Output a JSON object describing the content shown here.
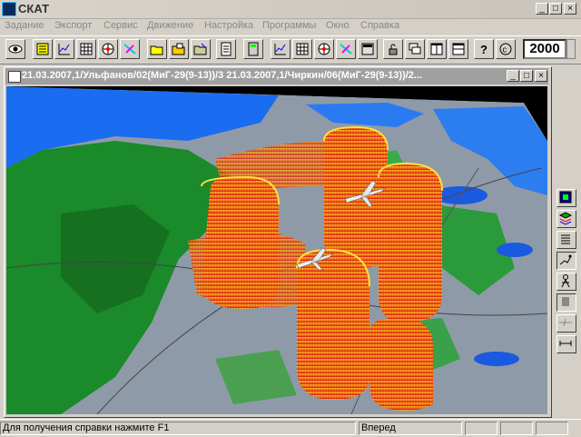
{
  "app": {
    "title": "СКАТ"
  },
  "menu": [
    "Задание",
    "Экспорт",
    "Сервис",
    "Движение",
    "Настройка",
    "Программы",
    "Окно",
    "Справка"
  ],
  "toolbar": {
    "year_value": "2000"
  },
  "child_window": {
    "title": "21.03.2007,1/Ульфанов/02(МиГ-29(9-13))/3 21.03.2007,1/Чиркин/06(МиГ-29(9-13))/2..."
  },
  "status": {
    "help_text": "Для получения справки нажмите F1",
    "mode_text": "Вперед"
  },
  "colors": {
    "track_top": "#ffd020",
    "track_bottom": "#e01010",
    "terrain_green": "#1a8a2a",
    "water": "#1a5ae0"
  }
}
